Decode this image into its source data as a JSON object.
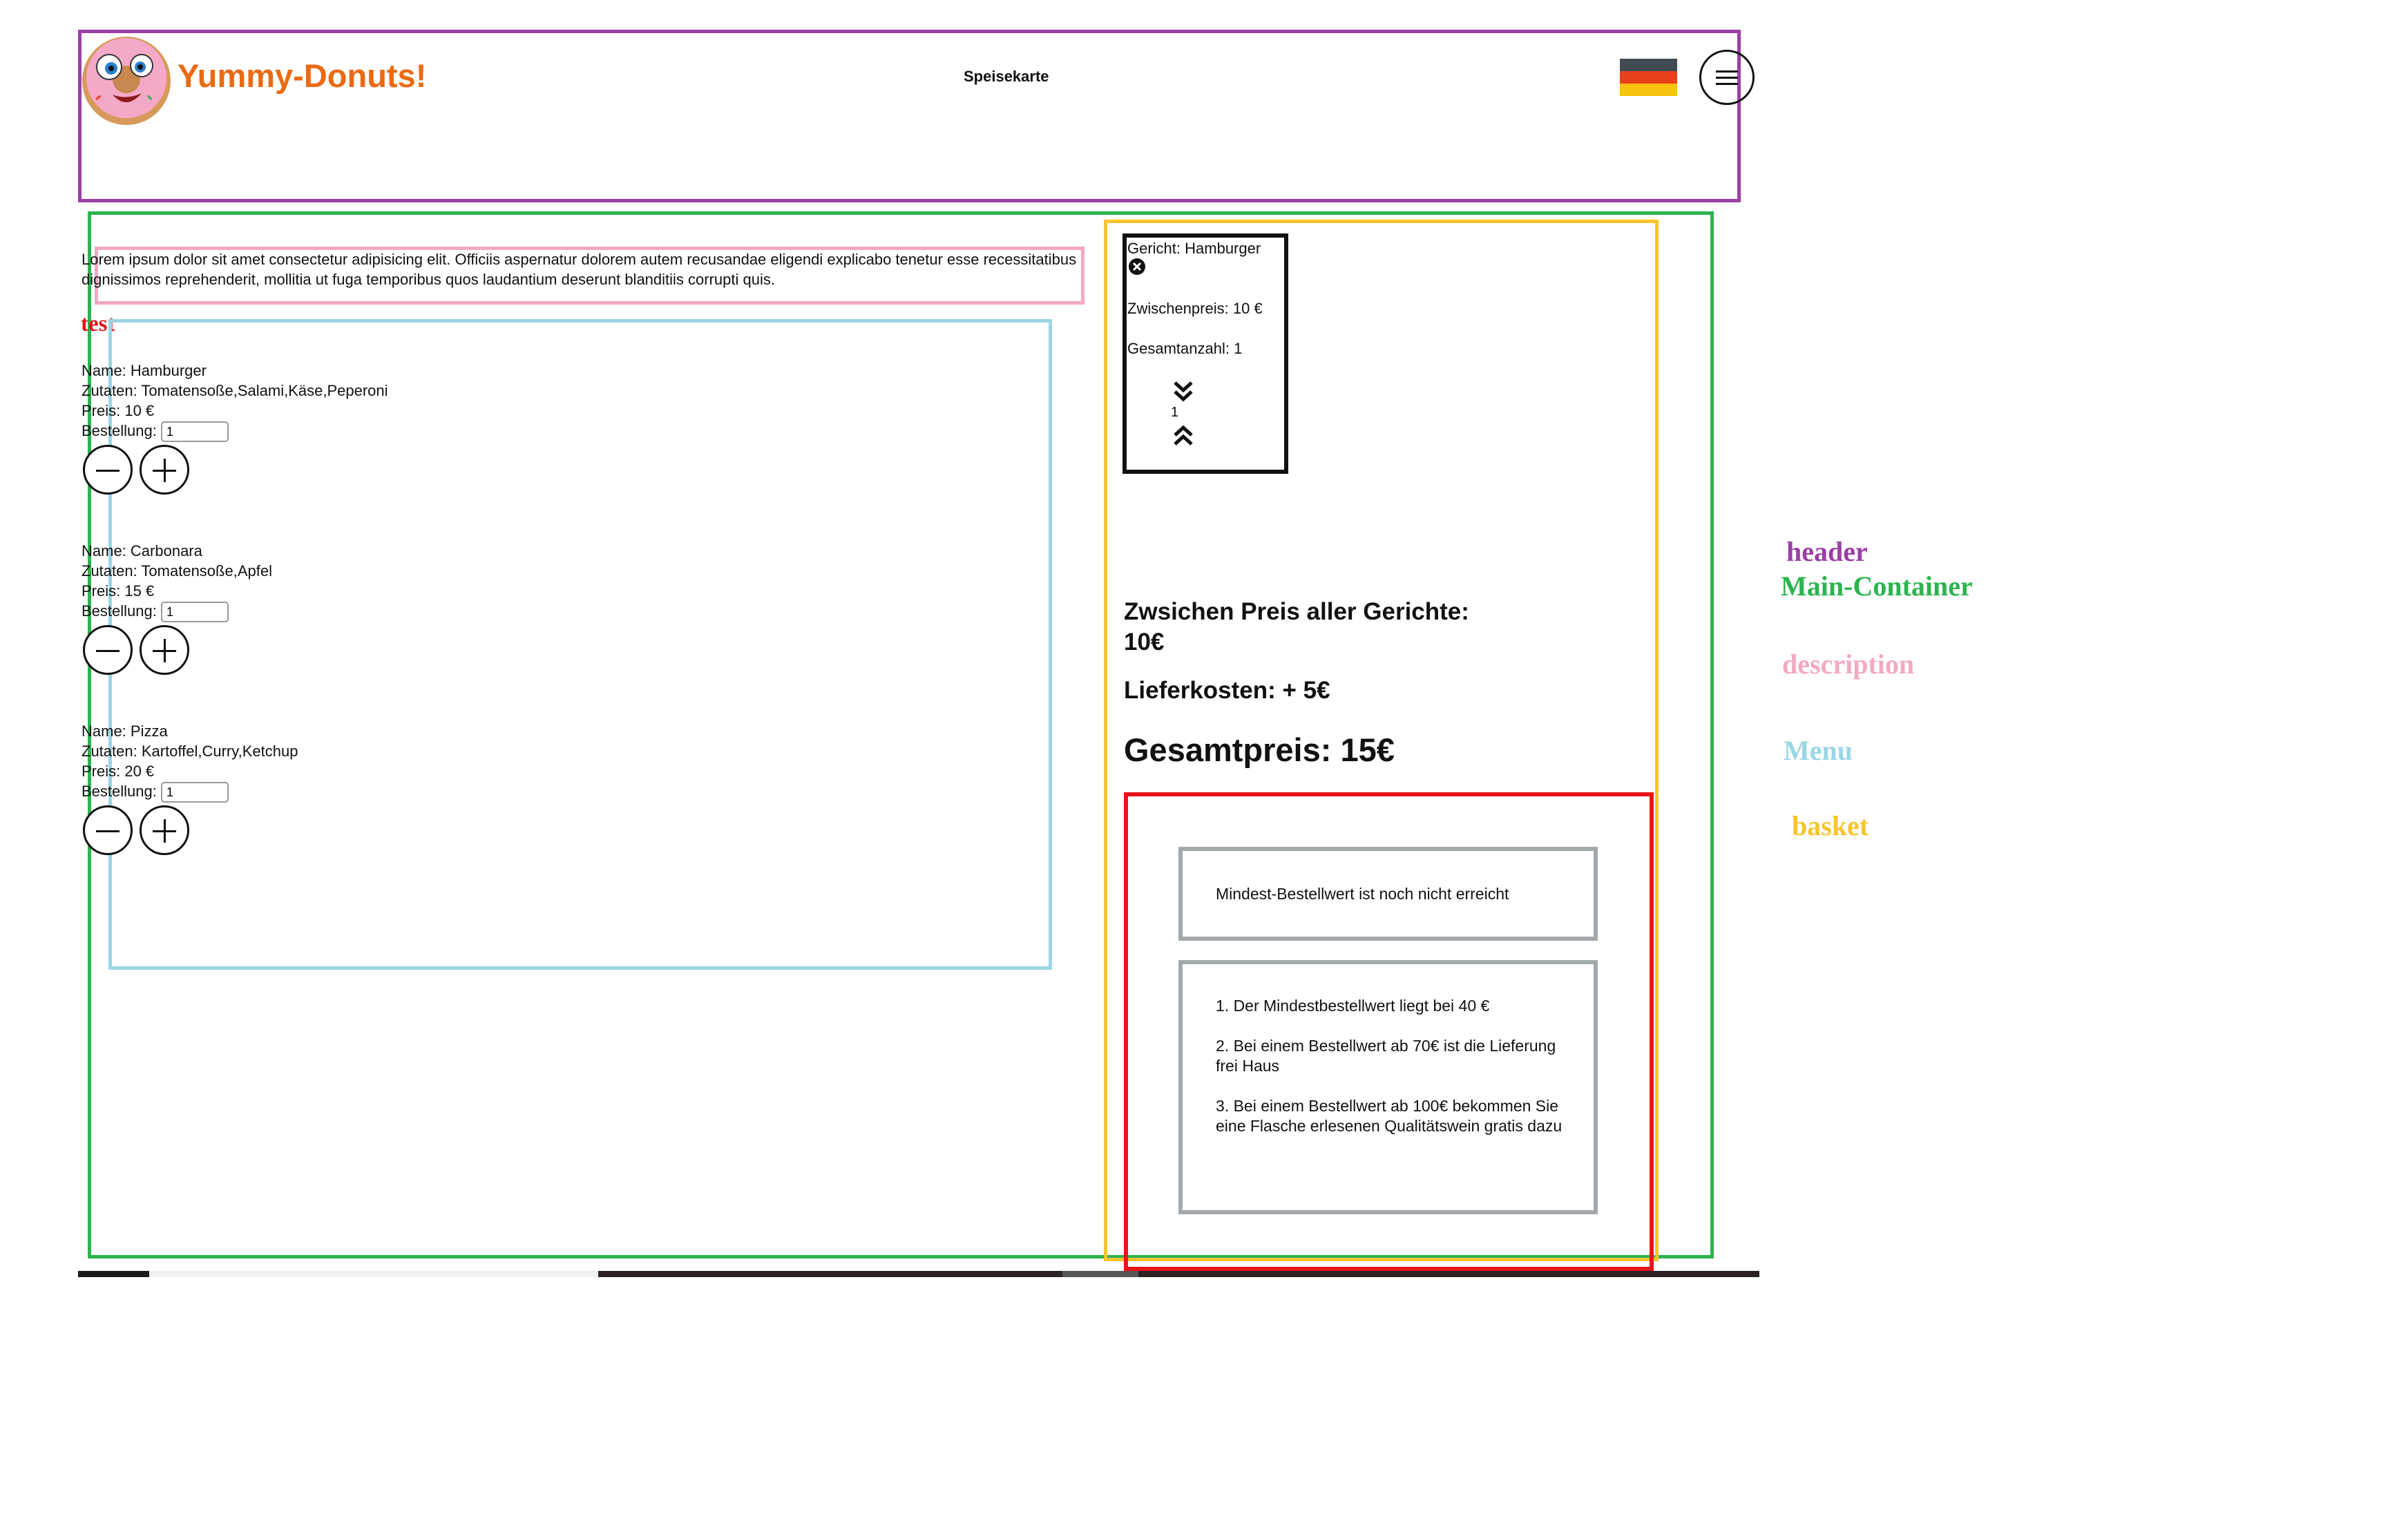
{
  "header": {
    "brand": "Yummy-Donuts!",
    "nav_link": "Speisekarte",
    "flag_colors": [
      "#3f4a52",
      "#e8401c",
      "#f6c40e"
    ],
    "menu_icon": "hamburger-menu-icon",
    "logo_icon": "donut-mascot-icon"
  },
  "description": {
    "text": "Lorem ipsum dolor sit amet consectetur adipisicing elit. Officiis aspernatur dolorem autem recusandae eligendi explicabo tenetur esse recessitatibus dignissimos reprehenderit, mollitia ut fuga temporibus quos laudantium deserunt blanditiis corrupti quis."
  },
  "test_label": "test",
  "menu": {
    "items": [
      {
        "name": "Name: Hamburger",
        "ingredients": "Zutaten: Tomatensoße,Salami,Käse,Peperoni",
        "price": "Preis: 10 €",
        "order_label": "Bestellung:",
        "order_value": "1"
      },
      {
        "name": "Name: Carbonara",
        "ingredients": "Zutaten: Tomatensoße,Apfel",
        "price": "Preis: 15 €",
        "order_label": "Bestellung:",
        "order_value": "1"
      },
      {
        "name": "Name: Pizza",
        "ingredients": "Zutaten: Kartoffel,Curry,Ketchup",
        "price": "Preis: 20 €",
        "order_label": "Bestellung:",
        "order_value": "1"
      }
    ]
  },
  "basket": {
    "item": {
      "dish": "Gericht: Hamburger",
      "subtotal": "Zwischenpreis: 10 €",
      "count": "Gesamtanzahl: 1",
      "quantity": "1"
    },
    "subtotal_label": "Zwsichen Preis aller Gerichte:",
    "subtotal_value": "10€",
    "delivery": "Lieferkosten: + 5€",
    "total": "Gesamtpreis: 15€",
    "minimum_notice": "Mindest-Bestellwert ist noch nicht erreicht",
    "rules": [
      "1. Der Mindestbestellwert liegt bei 40 €",
      "2. Bei einem Bestellwert ab 70€ ist die Lieferung frei Haus",
      "3. Bei einem Bestellwert ab 100€ bekommen Sie eine Flasche erlesenen Qualitätswein gratis dazu"
    ]
  },
  "legend": {
    "header": "header",
    "main": "Main-Container",
    "description": "description",
    "menu": "Menu",
    "basket": "basket",
    "colors": {
      "header": "#9c3fa6",
      "main": "#2bb44f",
      "description": "#f3a9c2",
      "menu": "#9ad6e4",
      "basket": "#f6c42c",
      "checkout": "#e8141c",
      "brand": "#ea6a12"
    }
  }
}
